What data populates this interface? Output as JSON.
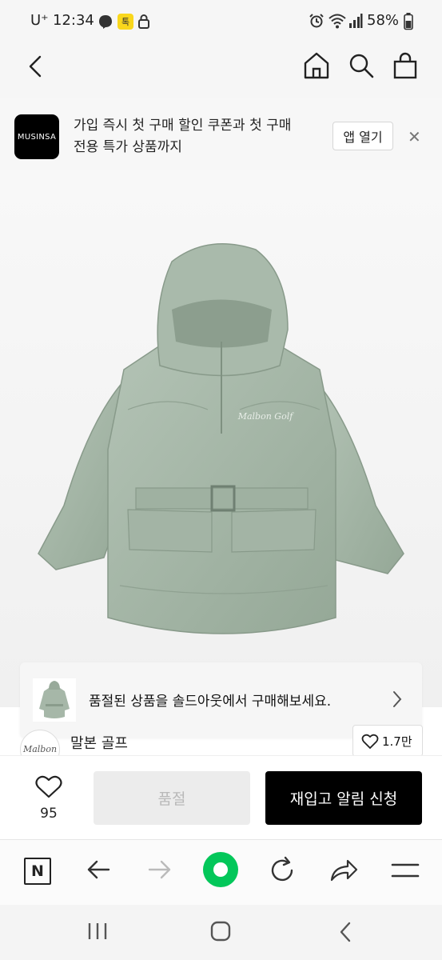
{
  "status_bar": {
    "carrier": "U⁺",
    "time": "12:34",
    "battery": "58%",
    "icons": [
      "messenger-icon",
      "kakaotalk-icon",
      "lock-icon",
      "alarm-icon",
      "wifi-icon",
      "signal-icon",
      "battery-icon"
    ]
  },
  "header": {
    "icons": [
      "back-chevron-icon",
      "home-icon",
      "search-icon",
      "shopping-bag-icon"
    ]
  },
  "banner": {
    "logo_text": "MUSINSA",
    "message_line1": "가입 즉시 첫 구매 할인 쿠폰과 첫 구매",
    "message_line2": "전용 특가 상품까지",
    "open_app_label": "앱 열기",
    "close_label": "✕"
  },
  "product": {
    "image_subject": "sage green padded hooded anorak jacket with belt",
    "chest_logo_text": "Malbon Golf",
    "color": "#a8b9aa"
  },
  "soldout_card": {
    "message": "품절된 상품을 솔드아웃에서 구매해보세요."
  },
  "brand": {
    "logo_text": "Malbon",
    "name": "말본 골프",
    "like_count": "1.7만"
  },
  "actions": {
    "heart_count": "95",
    "soldout_label": "품절",
    "restock_label": "재입고 알림 신청"
  },
  "browser_toolbar": {
    "icons": [
      "naver-n-icon",
      "back-arrow-icon",
      "forward-arrow-icon",
      "green-home-icon",
      "refresh-icon",
      "share-icon",
      "menu-icon"
    ],
    "naver_label": "N"
  },
  "system_nav": {
    "icons": [
      "recents-icon",
      "home-button-icon",
      "back-button-icon"
    ]
  },
  "colors": {
    "brand_black": "#000000",
    "naver_green": "#03c75a",
    "disabled_grey": "#ececec"
  }
}
